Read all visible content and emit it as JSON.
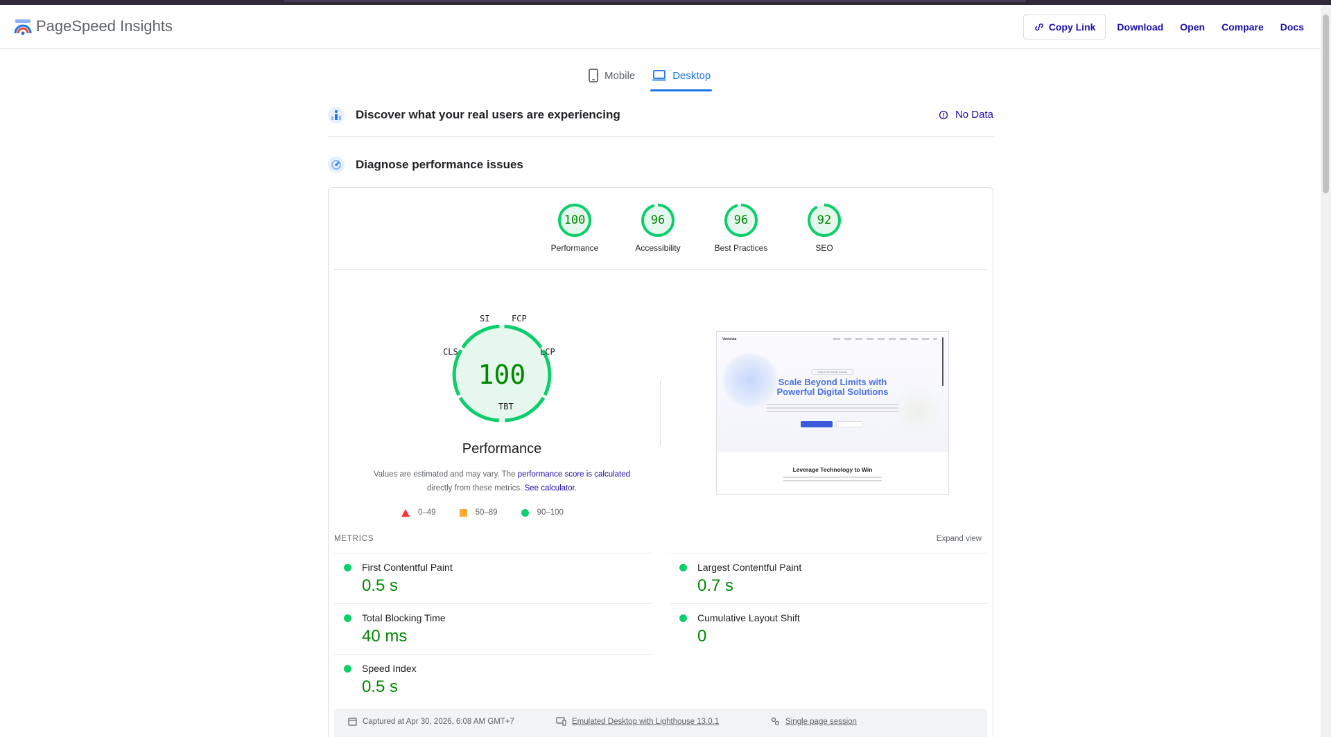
{
  "header": {
    "brand": "PageSpeed Insights",
    "actions": {
      "copy_link": "Copy Link",
      "download": "Download",
      "open": "Open",
      "compare": "Compare",
      "docs": "Docs"
    }
  },
  "tabs": [
    {
      "label": "Mobile",
      "icon": "phone-icon",
      "active": false
    },
    {
      "label": "Desktop",
      "icon": "laptop-icon",
      "active": true
    }
  ],
  "field_data": {
    "title": "Discover what your real users are experiencing",
    "status": "No Data"
  },
  "lab_data": {
    "title": "Diagnose performance issues",
    "scores": [
      {
        "label": "Performance",
        "value": "100"
      },
      {
        "label": "Accessibility",
        "value": "96"
      },
      {
        "label": "Best Practices",
        "value": "96"
      },
      {
        "label": "SEO",
        "value": "92"
      }
    ],
    "main_gauge": {
      "score": "100",
      "title": "Performance",
      "segments": {
        "si": "SI",
        "fcp": "FCP",
        "lcp": "LCP",
        "tbt": "TBT",
        "cls": "CLS"
      }
    },
    "note": {
      "prefix": "Values are estimated and may vary. The ",
      "link1": "performance score is calculated",
      "middle": "directly from these metrics. ",
      "link2": "See calculator."
    },
    "legend": {
      "fail": "0–49",
      "average": "50–89",
      "pass": "90–100"
    },
    "screenshot": {
      "brand": "Vectovia",
      "badge": "Code to Your Ultimate Leverage",
      "headline_1": "Scale Beyond Limits with",
      "headline_2": "Powerful Digital Solutions",
      "section_title": "Leverage Technology to Win"
    },
    "metrics_heading": "METRICS",
    "expand_view": "Expand view",
    "metrics": [
      {
        "name": "First Contentful Paint",
        "value": "0.5 s"
      },
      {
        "name": "Largest Contentful Paint",
        "value": "0.7 s"
      },
      {
        "name": "Total Blocking Time",
        "value": "40 ms"
      },
      {
        "name": "Cumulative Layout Shift",
        "value": "0"
      },
      {
        "name": "Speed Index",
        "value": "0.5 s"
      }
    ],
    "footer": {
      "captured": "Captured at Apr 30, 2026, 6:08 AM GMT+7",
      "emulated": "Emulated Desktop with Lighthouse 13.0.1",
      "session": "Single page session"
    }
  },
  "colors": {
    "pass": "#0cce6b",
    "pass_text": "#008800",
    "average": "#ffaa33",
    "fail": "#ff3333",
    "link": "#1a0dab",
    "accent": "#1a73e8"
  }
}
